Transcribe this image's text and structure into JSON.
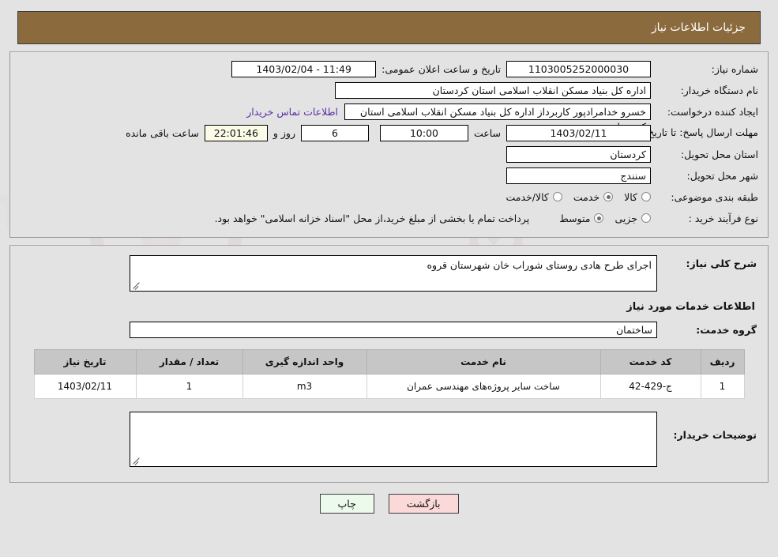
{
  "header": {
    "title": "جزئیات اطلاعات نیاز"
  },
  "watermark": {
    "text": "AnaTender.net"
  },
  "colors": {
    "header_bar": "#8b6b3d",
    "page_background": "#e3e3e3",
    "table_header": "#c6c6c6",
    "link": "#5b2ea6",
    "print_button": "#ecfaec",
    "back_button": "#fbd9d9",
    "countdown_field": "#fbfbe8"
  },
  "form": {
    "need_number": {
      "label": "شماره نیاز:",
      "value": "1103005252000030"
    },
    "public_announce": {
      "label": "تاریخ و ساعت اعلان عمومی:",
      "value": "1403/02/04 - 11:49"
    },
    "buyer_org": {
      "label": "نام دستگاه خریدار:",
      "value": "اداره کل بنیاد مسکن انقلاب اسلامی استان کردستان"
    },
    "request_creator": {
      "label": "ایجاد کننده درخواست:",
      "value": "خسرو خدامرادپور کاربرداز اداره کل بنیاد مسکن انقلاب اسلامی استان کردستان",
      "contact_link": "اطلاعات تماس خریدار"
    },
    "deadline": {
      "label": "مهلت ارسال پاسخ: تا تاریخ:",
      "date": "1403/02/11",
      "time_label": "ساعت",
      "time": "10:00",
      "days": "6",
      "days_label": "روز و",
      "countdown": "22:01:46",
      "countdown_label": "ساعت باقی مانده"
    },
    "delivery_province": {
      "label": "استان محل تحویل:",
      "value": "کردستان"
    },
    "delivery_city": {
      "label": "شهر محل تحویل:",
      "value": "سنندج"
    },
    "subject_category": {
      "label": "طبقه بندی موضوعی:",
      "options": [
        {
          "label": "کالا",
          "selected": false
        },
        {
          "label": "خدمت",
          "selected": true
        },
        {
          "label": "کالا/خدمت",
          "selected": false
        }
      ]
    },
    "purchase_process": {
      "label": "نوع فرآیند خرید :",
      "options": [
        {
          "label": "جزیی",
          "selected": false
        },
        {
          "label": "متوسط",
          "selected": true
        }
      ],
      "note": "پرداخت تمام یا بخشی از مبلغ خرید،از محل \"اسناد خزانه اسلامی\" خواهد بود."
    }
  },
  "details": {
    "general_description": {
      "label": "شرح کلی نیاز:",
      "value": "اجرای طرح هادی روستای شوراب خان شهرستان قروه"
    },
    "services_section_title": "اطلاعات خدمات مورد نیاز",
    "service_group": {
      "label": "گروه خدمت:",
      "value": "ساختمان"
    },
    "table": {
      "columns": [
        "ردیف",
        "کد خدمت",
        "نام خدمت",
        "واحد اندازه گیری",
        "تعداد / مقدار",
        "تاریخ نیاز"
      ],
      "rows": [
        {
          "row": "1",
          "service_code": "ج-429-42",
          "service_name": "ساخت سایر پروژه‌های مهندسی عمران",
          "unit": "m3",
          "quantity": "1",
          "need_date": "1403/02/11"
        }
      ]
    },
    "buyer_notes": {
      "label": "توضیحات خریدار:",
      "value": ""
    }
  },
  "footer": {
    "print_label": "چاپ",
    "back_label": "بازگشت"
  }
}
